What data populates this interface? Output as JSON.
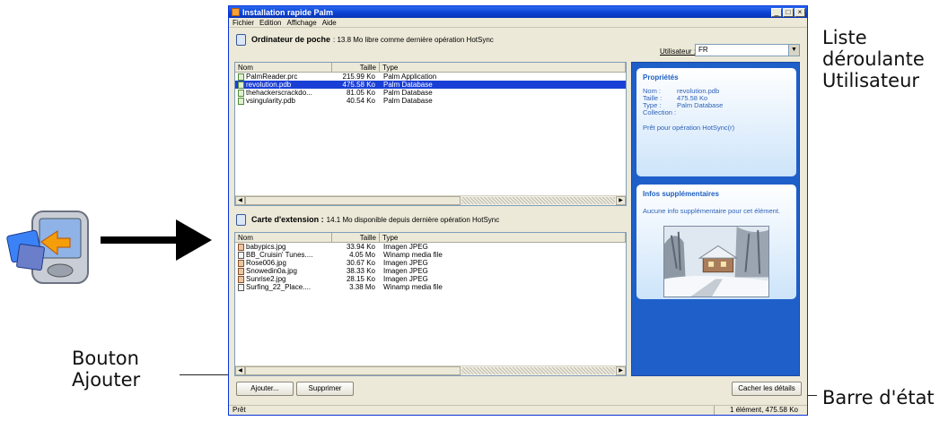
{
  "annotations": {
    "user_list": "Liste déroulante Utilisateur",
    "add_button": "Bouton Ajouter",
    "status_bar": "Barre d'état"
  },
  "window": {
    "title": "Installation rapide Palm",
    "controls": [
      "_",
      "□",
      "×"
    ]
  },
  "menu": [
    "Fichier",
    "Edition",
    "Affichage",
    "Aide"
  ],
  "handheld": {
    "title": "Ordinateur de poche",
    "info": ": 13.8 Mo libre comme dernière opération HotSync"
  },
  "user": {
    "label": "Utilisateur :",
    "selected": "FR"
  },
  "columns": [
    "Nom",
    "Taille",
    "Type"
  ],
  "handheld_files": [
    {
      "name": "PalmReader.prc",
      "size": "215.99 Ko",
      "type": "Palm Application",
      "icon": "palm-file-icon",
      "selected": false
    },
    {
      "name": "revolution.pdb",
      "size": "475.58 Ko",
      "type": "Palm Database",
      "icon": "palm-file-icon",
      "selected": true
    },
    {
      "name": "thehackerscrackdo...",
      "size": "81.05 Ko",
      "type": "Palm Database",
      "icon": "palm-file-icon",
      "selected": false
    },
    {
      "name": "vsingularity.pdb",
      "size": "40.54 Ko",
      "type": "Palm Database",
      "icon": "palm-file-icon",
      "selected": false
    }
  ],
  "card": {
    "title": "Carte d'extension :",
    "info": "14.1 Mo disponible depuis dernière opération HotSync"
  },
  "card_files": [
    {
      "name": "babypics.jpg",
      "size": "33.94 Ko",
      "type": "Imagen JPEG",
      "icon": "image-file-icon"
    },
    {
      "name": "BB_Cruisin' Tunes....",
      "size": "4.05 Mo",
      "type": "Winamp media file",
      "icon": "audio-file-icon"
    },
    {
      "name": "Rose006.jpg",
      "size": "30.67 Ko",
      "type": "Imagen JPEG",
      "icon": "image-file-icon"
    },
    {
      "name": "Snowedin0a.jpg",
      "size": "38.33 Ko",
      "type": "Imagen JPEG",
      "icon": "image-file-icon"
    },
    {
      "name": "Sunrise2.jpg",
      "size": "28.15 Ko",
      "type": "Imagen JPEG",
      "icon": "image-file-icon"
    },
    {
      "name": "Surfing_22_Place....",
      "size": "3.38 Mo",
      "type": "Winamp media file",
      "icon": "audio-file-icon"
    }
  ],
  "properties": {
    "title": "Propriétés",
    "rows": [
      {
        "key": "Nom :",
        "value": "revolution.pdb"
      },
      {
        "key": "Taille :",
        "value": "475.58 Ko"
      },
      {
        "key": "Type :",
        "value": "Palm Database"
      }
    ],
    "collection": "Collection :",
    "status": "Prêt pour opération HotSync(r)"
  },
  "more_info": {
    "title": "Infos supplémentaires",
    "text": "Aucune info supplémentaire pour cet élément."
  },
  "buttons": {
    "add": "Ajouter...",
    "delete": "Supprimer",
    "hide_details": "Cacher les détails"
  },
  "status": {
    "left": "Prêt",
    "right": "1 élément, 475.58 Ko"
  },
  "colors": {
    "titlebar": "#0a3fcf",
    "selection": "#1a3fd6",
    "side_panel": "#1f5fc9",
    "panel_text": "#2f62b7"
  }
}
